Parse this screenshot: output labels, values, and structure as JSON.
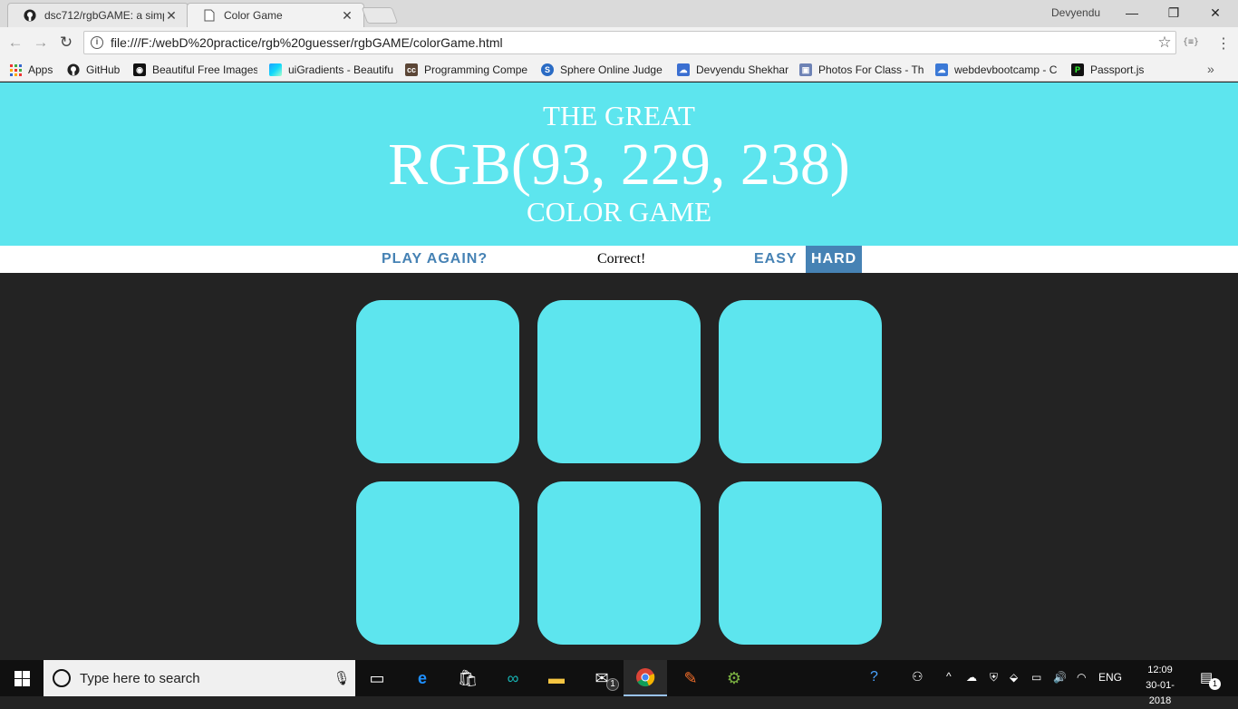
{
  "browser": {
    "tabs": [
      {
        "title": "dsc712/rgbGAME: a simp",
        "icon": "github-icon"
      },
      {
        "title": "Color Game",
        "icon": "page-icon"
      }
    ],
    "profile_name": "Devyendu",
    "url": "file:///F:/webD%20practice/rgb%20guesser/rgbGAME/colorGame.html",
    "bookmarks": [
      {
        "label": "Apps",
        "icon": "apps-grid-icon"
      },
      {
        "label": "GitHub",
        "icon": "github-icon"
      },
      {
        "label": "Beautiful Free Images",
        "icon": "camera-icon"
      },
      {
        "label": "uiGradients - Beautifu",
        "icon": "gradient-icon"
      },
      {
        "label": "Programming Compe",
        "icon": "codechef-icon"
      },
      {
        "label": "Sphere Online Judge",
        "icon": "spoj-icon"
      },
      {
        "label": "Devyendu Shekhar",
        "icon": "cloud-icon"
      },
      {
        "label": "Photos For Class - Th",
        "icon": "photo-icon"
      },
      {
        "label": "webdevbootcamp - C",
        "icon": "cloud9-icon"
      },
      {
        "label": "Passport.js",
        "icon": "passport-icon"
      }
    ]
  },
  "game": {
    "title_top": "THE GREAT",
    "color_display": "RGB(93, 229, 238)",
    "title_bottom": "COLOR GAME",
    "header_color": "#5de5ee",
    "reset_label": "PLAY AGAIN?",
    "message": "Correct!",
    "modes": [
      {
        "label": "EASY",
        "selected": false
      },
      {
        "label": "HARD",
        "selected": true
      }
    ],
    "squares": [
      "#5de5ee",
      "#5de5ee",
      "#5de5ee",
      "#5de5ee",
      "#5de5ee",
      "#5de5ee"
    ],
    "accent_color": "#4682b4",
    "background_color": "#232323"
  },
  "taskbar": {
    "search_placeholder": "Type here to search",
    "time": "12:09",
    "date": "30-01-2018",
    "language": "ENG",
    "notification_count": "1",
    "mail_badge": "1"
  }
}
